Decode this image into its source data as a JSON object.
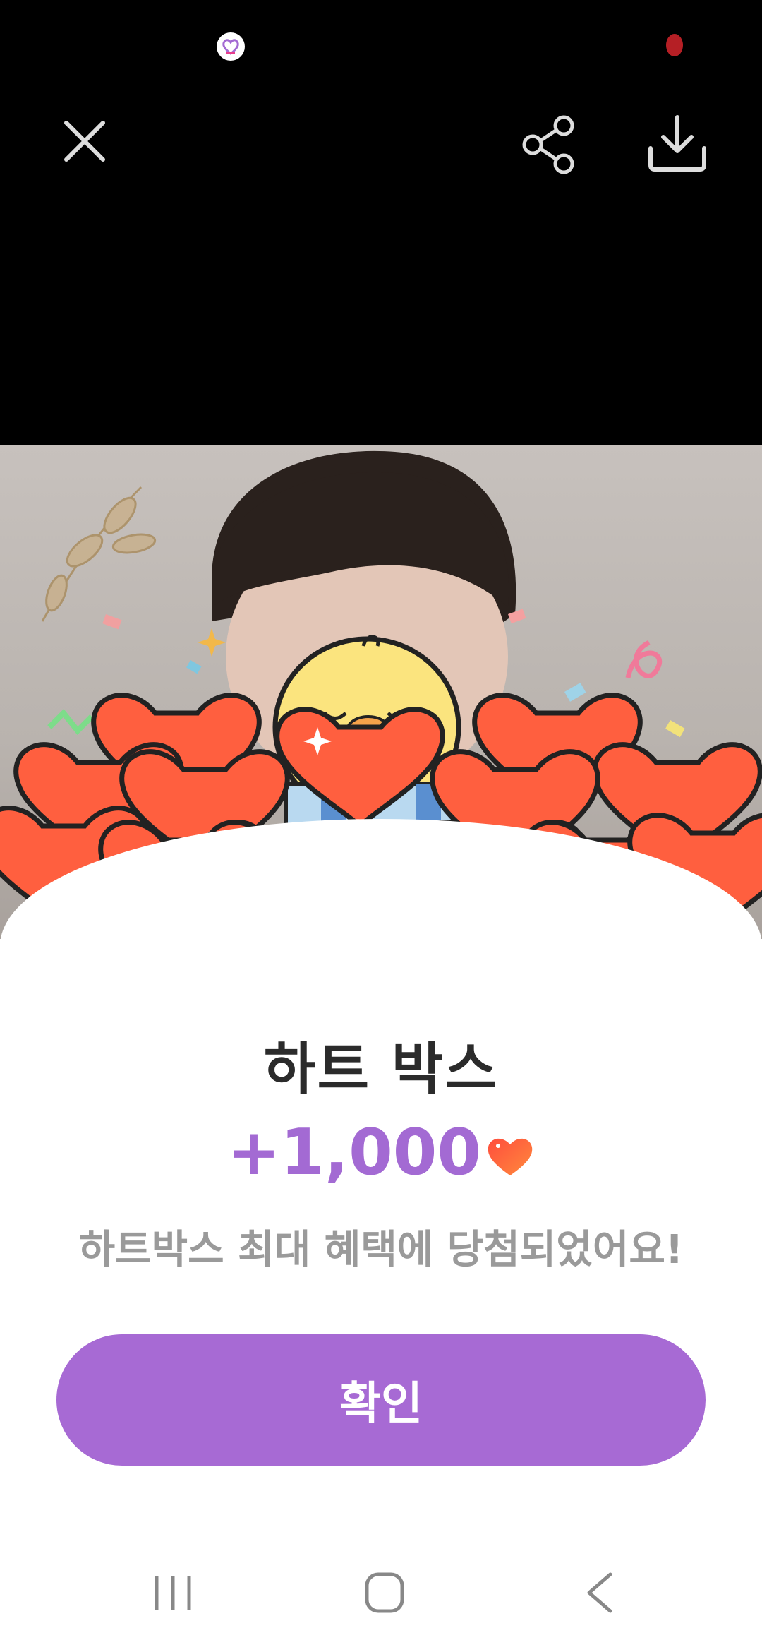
{
  "status_bar": {
    "app_icon": "heart-app-icon",
    "indicator_color": "#b51f25"
  },
  "toolbar": {
    "close_icon": "close-icon",
    "share_icon": "share-icon",
    "download_icon": "download-icon"
  },
  "result": {
    "title": "하트 박스",
    "reward_amount": "+1,000",
    "reward_icon": "heart-icon",
    "message": "하트박스 최대 혜택에 당첨되었어요!"
  },
  "confirm_button": {
    "label": "확인",
    "color": "#a76ad4"
  },
  "colors": {
    "accent": "#a36ad3",
    "heart": "#ff5a3c"
  },
  "navigation": {
    "recent_icon": "recent-apps-icon",
    "home_icon": "home-icon",
    "back_icon": "back-icon"
  }
}
